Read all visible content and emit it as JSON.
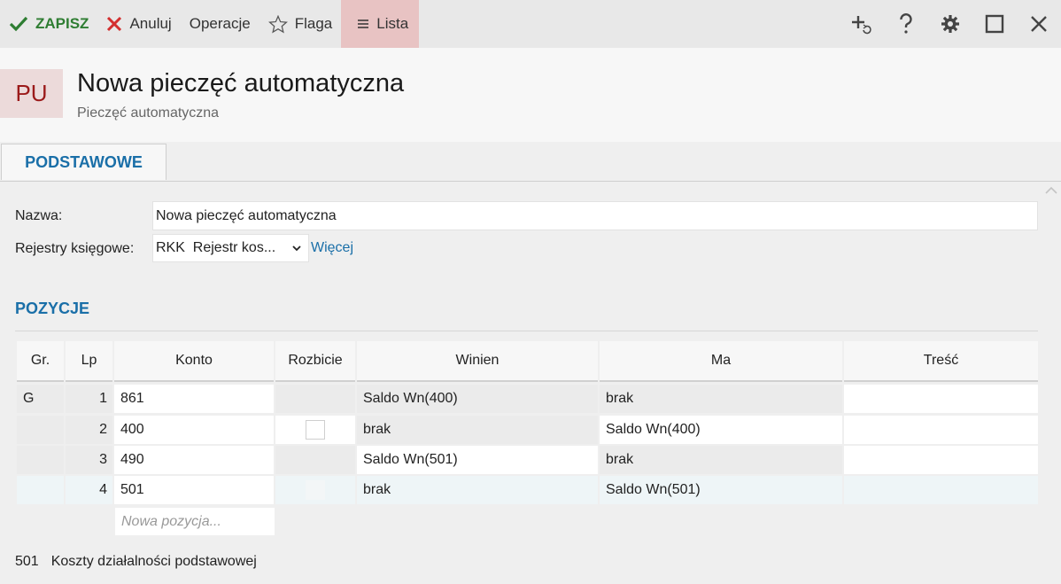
{
  "toolbar": {
    "save": "ZAPISZ",
    "cancel": "Anuluj",
    "operations": "Operacje",
    "flag": "Flaga",
    "list": "Lista",
    "colors": {
      "save": "#2e7d32",
      "cancel": "#d32f2f",
      "list_bg": "#e8c3c3"
    }
  },
  "header": {
    "badge": "PU",
    "title": "Nowa pieczęć automatyczna",
    "subtitle": "Pieczęć automatyczna"
  },
  "tabs": [
    {
      "label": "PODSTAWOWE",
      "active": true
    }
  ],
  "form": {
    "name_label": "Nazwa:",
    "name_value": "Nowa pieczęć automatyczna",
    "registers_label": "Rejestry księgowe:",
    "registers_value": "RKK  Rejestr kos...",
    "more_link": "Więcej"
  },
  "positions": {
    "section_title": "POZYCJE",
    "columns": [
      "Gr.",
      "Lp",
      "Konto",
      "Rozbicie",
      "Winien",
      "Ma",
      "Treść"
    ],
    "rows": [
      {
        "gr": "G",
        "lp": "1",
        "konto": "861",
        "rozbicie": "",
        "winien": "Saldo Wn(400)",
        "ma": "brak",
        "tresc": ""
      },
      {
        "gr": "",
        "lp": "2",
        "konto": "400",
        "rozbicie": "checkbox",
        "winien": "brak",
        "ma": "Saldo Wn(400)",
        "tresc": ""
      },
      {
        "gr": "",
        "lp": "3",
        "konto": "490",
        "rozbicie": "",
        "winien": "Saldo Wn(501)",
        "ma": "brak",
        "tresc": ""
      },
      {
        "gr": "",
        "lp": "4",
        "konto": "501",
        "rozbicie": "",
        "winien": "brak",
        "ma": "Saldo Wn(501)",
        "tresc": ""
      }
    ],
    "new_placeholder": "Nowa pozycja..."
  },
  "footer": {
    "code": "501",
    "description": "Koszty działalności podstawowej"
  },
  "icons": [
    "check-icon",
    "x-icon",
    "star-icon",
    "menu-icon",
    "add-refresh-icon",
    "help-icon",
    "gear-icon",
    "maximize-icon",
    "close-icon",
    "chevron-down-icon",
    "chevron-up-icon"
  ]
}
